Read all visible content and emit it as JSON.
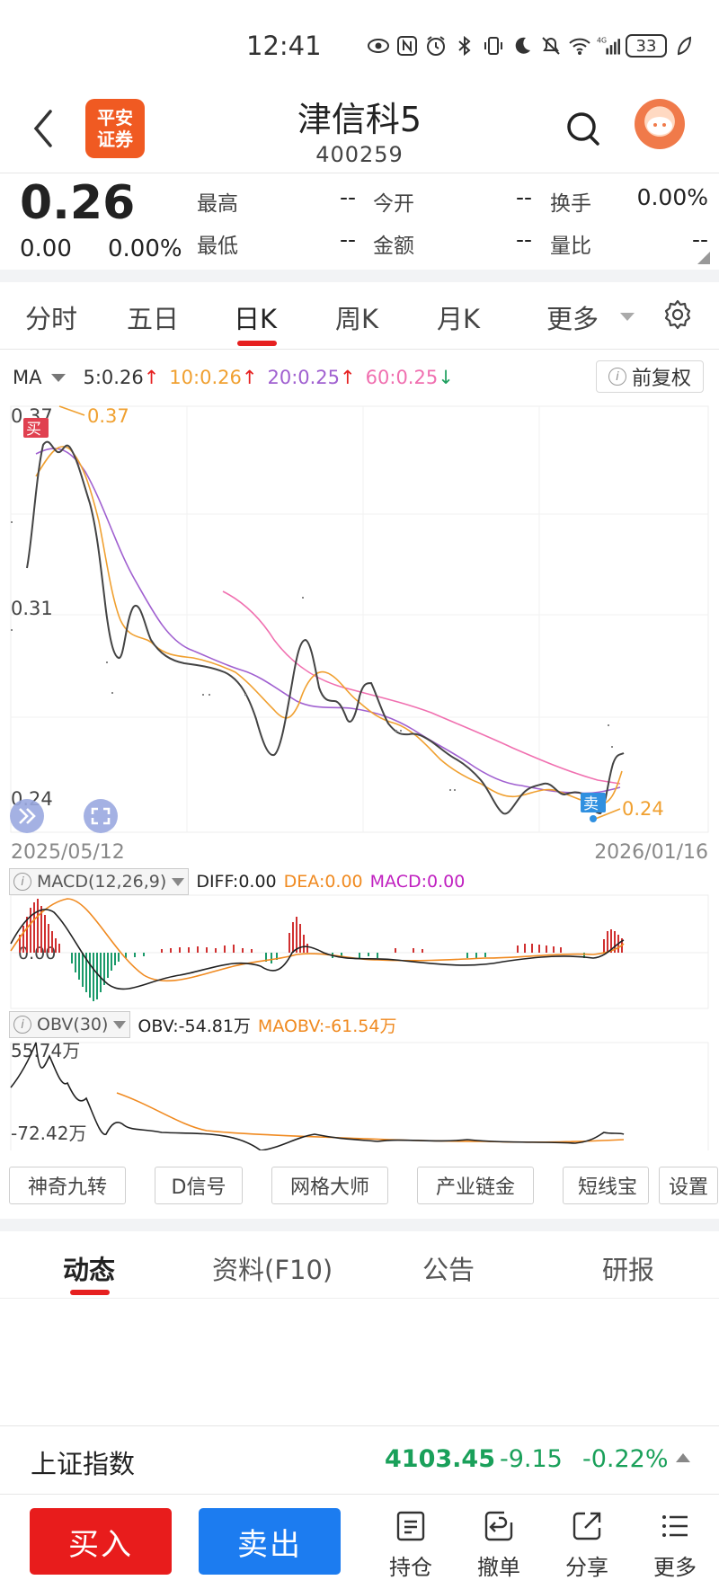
{
  "status_bar": {
    "time": "12:41",
    "battery": "33"
  },
  "header": {
    "title": "津信科5",
    "code": "400259",
    "logo_line1": "平安",
    "logo_line2": "证券"
  },
  "quote": {
    "price": "0.26",
    "change": "0.00",
    "change_pct": "0.00%",
    "fields": [
      {
        "label": "最高",
        "value": "--"
      },
      {
        "label": "今开",
        "value": "--"
      },
      {
        "label": "换手",
        "value": "0.00%"
      },
      {
        "label": "最低",
        "value": "--"
      },
      {
        "label": "金额",
        "value": "--"
      },
      {
        "label": "量比",
        "value": "--"
      }
    ]
  },
  "period_tabs": [
    "分时",
    "五日",
    "日K",
    "周K",
    "月K",
    "更多"
  ],
  "active_period": "日K",
  "ma": {
    "label": "MA",
    "items": [
      {
        "text": "5:0.26",
        "arrow": "↑",
        "color": "#333333",
        "arrow_color": "#e62020"
      },
      {
        "text": "10:0.26",
        "arrow": "↑",
        "color": "#f0a030",
        "arrow_color": "#e62020"
      },
      {
        "text": "20:0.25",
        "arrow": "↑",
        "color": "#a060d0",
        "arrow_color": "#e62020"
      },
      {
        "text": "60:0.25",
        "arrow": "↓",
        "color": "#f070b0",
        "arrow_color": "#20a060"
      }
    ],
    "adjust_label": "前复权"
  },
  "kline": {
    "y_labels": [
      "0.37",
      "0.31",
      "0.24"
    ],
    "date_start": "2025/05/12",
    "date_end": "2026/01/16",
    "high_label": "0.37",
    "low_label": "0.24",
    "buy_marker": "买",
    "sell_marker": "卖"
  },
  "macd": {
    "label": "MACD(12,26,9)",
    "diff": "DIFF:0.00",
    "dea": "DEA:0.00",
    "macd": "MACD:0.00",
    "zero_label": "0.00",
    "diff_color": "#222222",
    "dea_color": "#f08a20",
    "macd_color": "#c020c0"
  },
  "obv": {
    "label": "OBV(30)",
    "obv": "OBV:-54.81万",
    "maobv": "MAOBV:-61.54万",
    "y_top": "55.74万",
    "y_bottom": "-72.42万"
  },
  "tools": [
    "神奇九转",
    "D信号",
    "网格大师",
    "产业链金",
    "短线宝",
    "设置"
  ],
  "news_tabs": [
    "动态",
    "资料(F10)",
    "公告",
    "研报"
  ],
  "index": {
    "name": "上证指数",
    "value": "4103.45",
    "change": "-9.15",
    "change_pct": "-0.22%"
  },
  "bottom_bar": {
    "buy": "买入",
    "sell": "卖出",
    "nav": [
      "持仓",
      "撤单",
      "分享",
      "更多"
    ]
  },
  "colors": {
    "up": "#e62020",
    "down": "#1aa05a",
    "accent": "#e62020",
    "buy": "#e81c1c",
    "sell": "#1c7cf0"
  }
}
